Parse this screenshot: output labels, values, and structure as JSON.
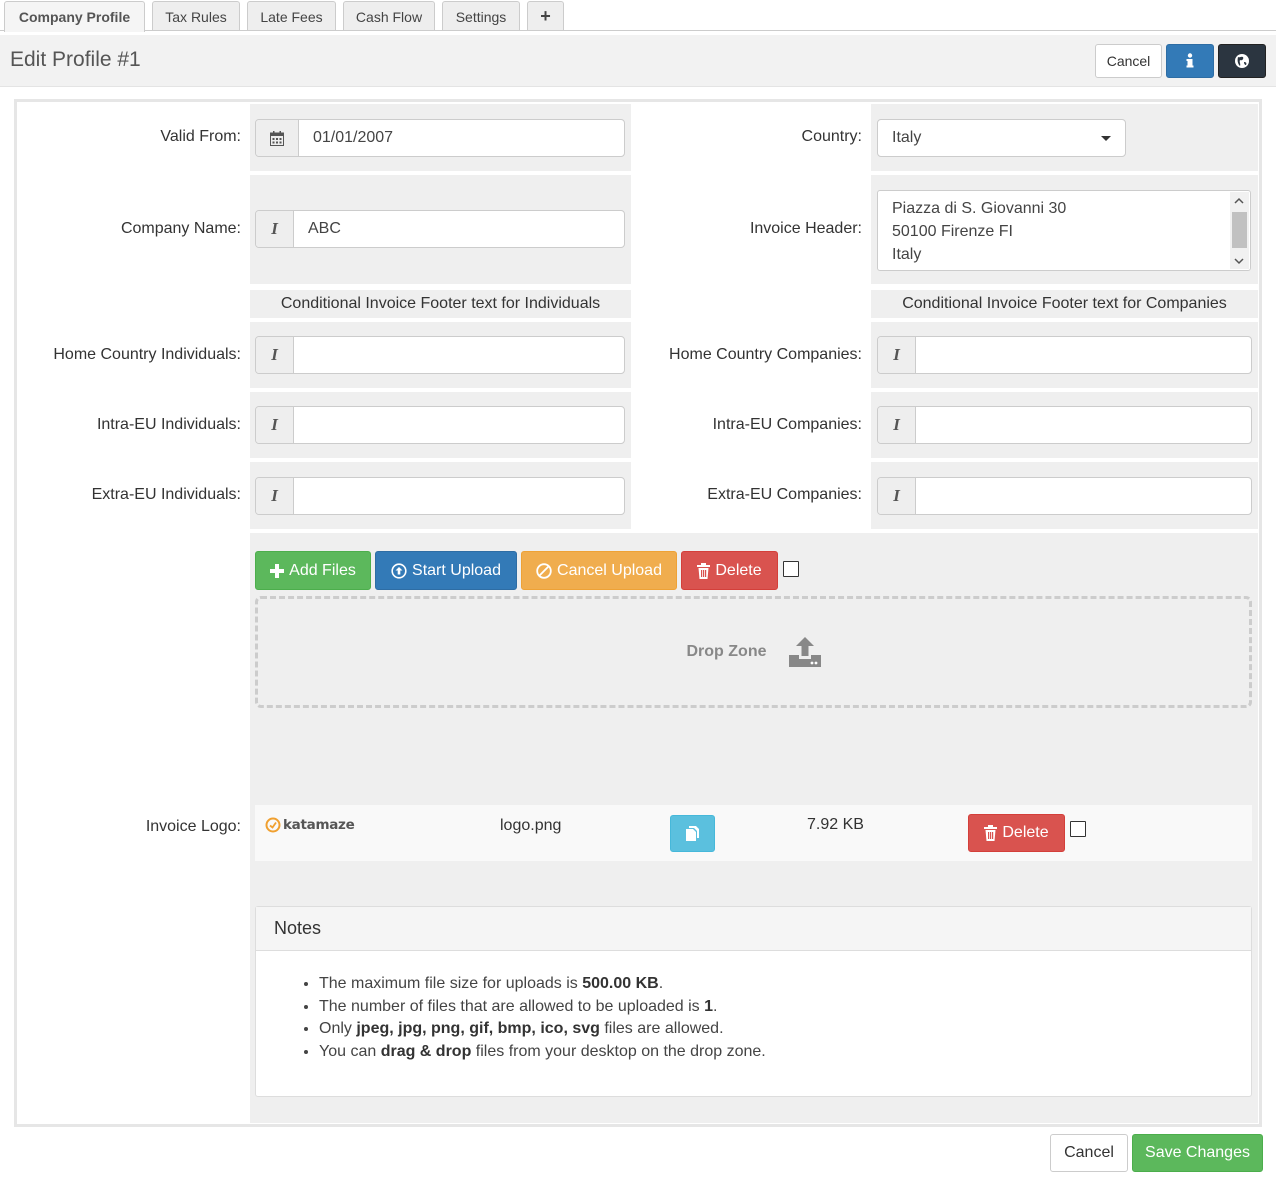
{
  "tabs": [
    {
      "label": "Company Profile",
      "active": true
    },
    {
      "label": "Tax Rules"
    },
    {
      "label": "Late Fees"
    },
    {
      "label": "Cash Flow"
    },
    {
      "label": "Settings"
    },
    {
      "label": "+"
    }
  ],
  "header": {
    "title": "Edit Profile #1",
    "cancel_label": "Cancel",
    "info_icon": "info-icon",
    "globe_icon": "globe-icon"
  },
  "form": {
    "valid_from": {
      "label": "Valid From:",
      "value": "01/01/2007",
      "icon": "calendar-icon"
    },
    "country": {
      "label": "Country:",
      "value": "Italy"
    },
    "company_name": {
      "label": "Company Name:",
      "value": "ABC",
      "icon": "italic-icon"
    },
    "invoice_header": {
      "label": "Invoice Header:",
      "lines": [
        "Piazza di S. Giovanni 30",
        "50100 Firenze FI",
        "Italy"
      ]
    },
    "individuals_heading": "Conditional Invoice Footer text for Individuals",
    "companies_heading": "Conditional Invoice Footer text for Companies",
    "home_individuals": {
      "label": "Home Country Individuals:",
      "value": ""
    },
    "intra_individuals": {
      "label": "Intra-EU Individuals:",
      "value": ""
    },
    "extra_individuals": {
      "label": "Extra-EU Individuals:",
      "value": ""
    },
    "home_companies": {
      "label": "Home Country Companies:",
      "value": ""
    },
    "intra_companies": {
      "label": "Intra-EU Companies:",
      "value": ""
    },
    "extra_companies": {
      "label": "Extra-EU Companies:",
      "value": ""
    }
  },
  "upload": {
    "add_files": "Add Files",
    "start_upload": "Start Upload",
    "cancel_upload": "Cancel Upload",
    "delete": "Delete",
    "drop_zone": "Drop Zone",
    "logo_label": "Invoice Logo:",
    "file": {
      "logo_text": "katamaze",
      "name": "logo.png",
      "size": "7.92 KB",
      "delete": "Delete"
    }
  },
  "notes": {
    "title": "Notes",
    "items": [
      {
        "pre": "The maximum file size for uploads is ",
        "bold": "500.00 KB",
        "post": "."
      },
      {
        "pre": "The number of files that are allowed to be uploaded is ",
        "bold": "1",
        "post": "."
      },
      {
        "pre": "Only ",
        "bold": "jpeg, jpg, png, gif, bmp, ico, svg",
        "post": " files are allowed."
      },
      {
        "pre": "You can ",
        "bold": "drag & drop",
        "post": " files from your desktop on the drop zone."
      }
    ]
  },
  "footer": {
    "cancel": "Cancel",
    "save": "Save Changes"
  },
  "colors": {
    "green": "#5cb85c",
    "blue": "#337ab7",
    "orange": "#f0ad4e",
    "red": "#d9534f",
    "cyan": "#5bc0de",
    "dark": "#2b3540"
  }
}
